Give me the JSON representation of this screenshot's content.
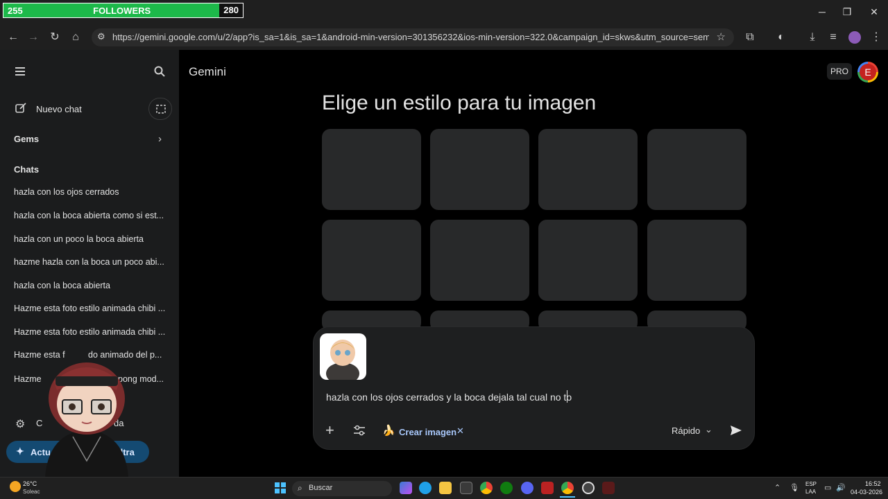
{
  "overlay": {
    "current": "255",
    "label": "FOLLOWERS",
    "goal": "280",
    "progress": 0.91
  },
  "browser": {
    "url": "https://gemini.google.com/u/2/app?is_sa=1&is_sa=1&android-min-version=301356232&ios-min-version=322.0&campaign_id=skws&utm_source=sem&utm_sour..."
  },
  "sidebar": {
    "new_chat": "Nuevo chat",
    "gems": "Gems",
    "chats_header": "Chats",
    "chats": [
      "hazla con los ojos cerrados",
      "hazla con la boca abierta como si est...",
      "hazla con un poco la boca abierta",
      "hazme hazla con la boca un poco abi...",
      "hazla con la boca abierta",
      "Hazme esta foto estilo animada chibi ...",
      "Hazme esta foto estilo animada chibi ...",
      "Hazme esta f",
      "Hazme"
    ],
    "chat_partial_tail_8": "do animado del p...",
    "chat_partial_tail_9": "pong mod...",
    "settings_tail": "da",
    "upgrade_head": "Actu",
    "upgrade_tail": "I Ultra"
  },
  "header": {
    "app_name": "Gemini",
    "pro_badge": "PRO",
    "avatar_letter": "E"
  },
  "main": {
    "heading": "Elige un estilo para tu imagen"
  },
  "composer": {
    "input_text": "hazla con los ojos cerrados y la boca dejala tal cual no to",
    "chip_label": "Crear imagen",
    "chip_emoji": "🍌",
    "mode": "Rápido"
  },
  "taskbar": {
    "weather_temp": "26°C",
    "weather_desc": "Soleac",
    "search_placeholder": "Buscar",
    "lang_top": "ESP",
    "lang_bottom": "LAA",
    "time": "16:52",
    "date": "04-03-2026"
  },
  "colors": {
    "accent": "#1db94a",
    "pill": "#144a72",
    "avatar_red": "#c5221f"
  }
}
